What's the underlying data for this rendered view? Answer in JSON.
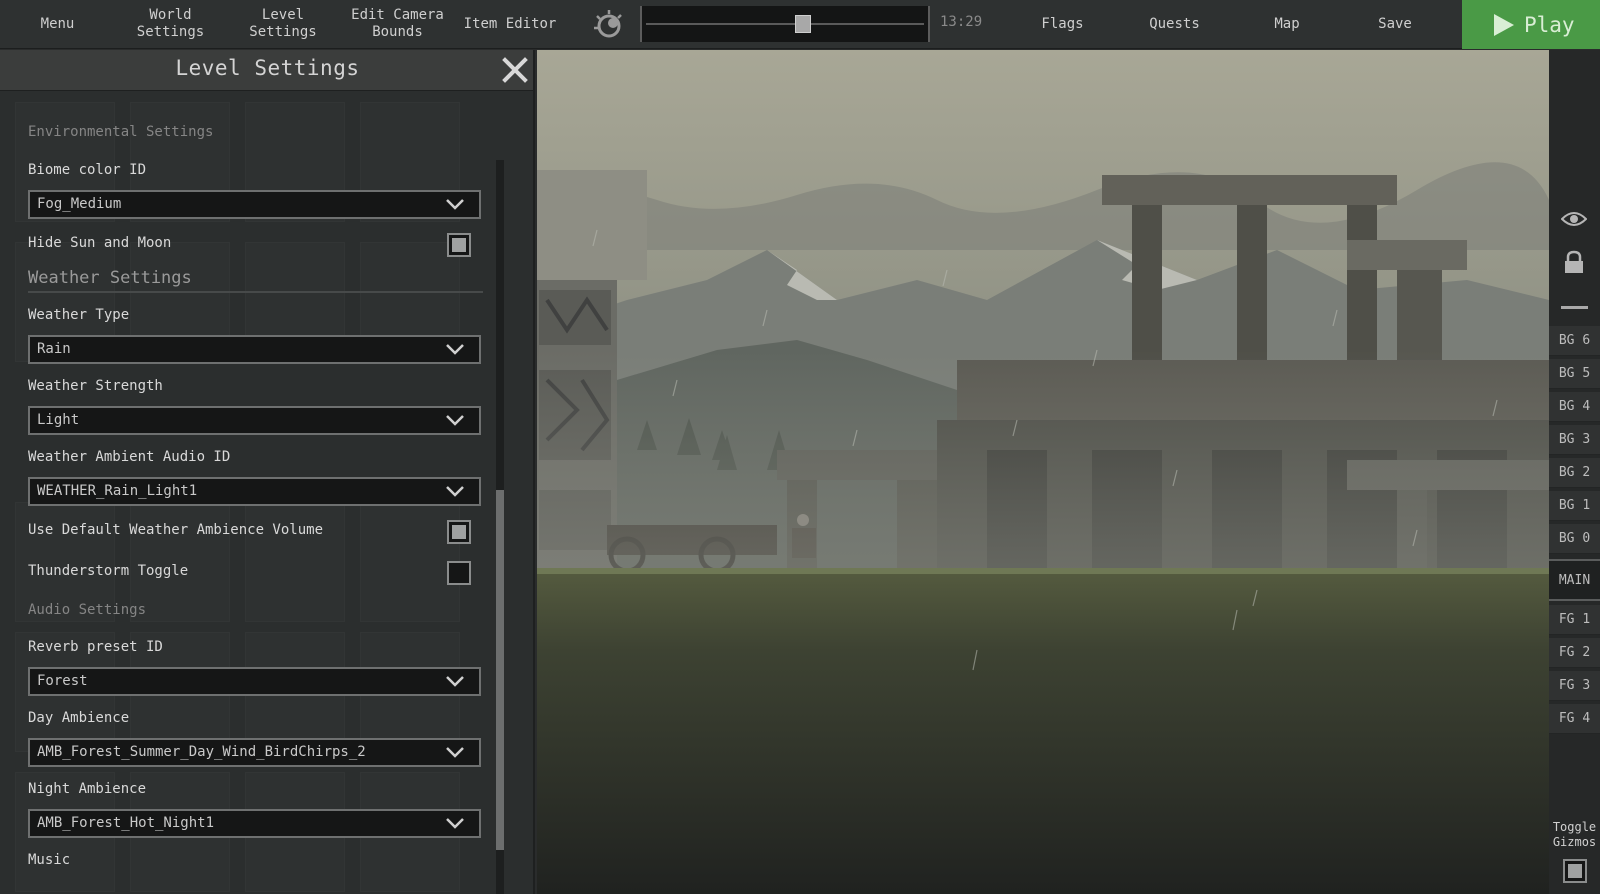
{
  "topbar": {
    "menu": "Menu",
    "world_settings": "World\nSettings",
    "level_settings": "Level Settings",
    "edit_camera_bounds": "Edit Camera\nBounds",
    "item_editor": "Item Editor",
    "time": "13:29",
    "time_of_day_fraction": 0.55,
    "flags": "Flags",
    "quests": "Quests",
    "map": "Map",
    "save": "Save",
    "play": "Play",
    "play_color": "#4a9a46"
  },
  "panel": {
    "title": "Level Settings",
    "environmental_header": "Environmental Settings",
    "biome_label": "Biome color ID",
    "biome_value": "Fog_Medium",
    "hide_sun_label": "Hide Sun and Moon",
    "hide_sun_checked": true,
    "weather_header": "Weather Settings",
    "weather_type_label": "Weather Type",
    "weather_type_value": "Rain",
    "weather_strength_label": "Weather Strength",
    "weather_strength_value": "Light",
    "weather_audio_label": "Weather Ambient Audio ID",
    "weather_audio_value": "WEATHER_Rain_Light1",
    "default_volume_label": "Use Default Weather Ambience Volume",
    "default_volume_checked": true,
    "thunder_label": "Thunderstorm Toggle",
    "thunder_checked": false,
    "audio_header": "Audio Settings",
    "reverb_label": "Reverb preset ID",
    "reverb_value": "Forest",
    "day_ambience_label": "Day Ambience",
    "day_ambience_value": "AMB_Forest_Summer_Day_Wind_BirdChirps_2",
    "night_ambience_label": "Night Ambience",
    "night_ambience_value": "AMB_Forest_Hot_Night1",
    "music_label": "Music"
  },
  "layers": {
    "items": [
      "BG 6",
      "BG 5",
      "BG 4",
      "BG 3",
      "BG 2",
      "BG 1",
      "BG 0",
      "MAIN",
      "FG 1",
      "FG 2",
      "FG 3",
      "FG 4"
    ],
    "active": "MAIN",
    "toggle_gizmos": "Toggle\nGizmos",
    "gizmos_checked": true
  },
  "icons": {
    "sun": "sun-moon-icon",
    "close": "close-icon",
    "chevron": "chevron-down-icon",
    "eye": "eye-icon",
    "lock": "lock-icon",
    "minus": "minus-icon"
  }
}
